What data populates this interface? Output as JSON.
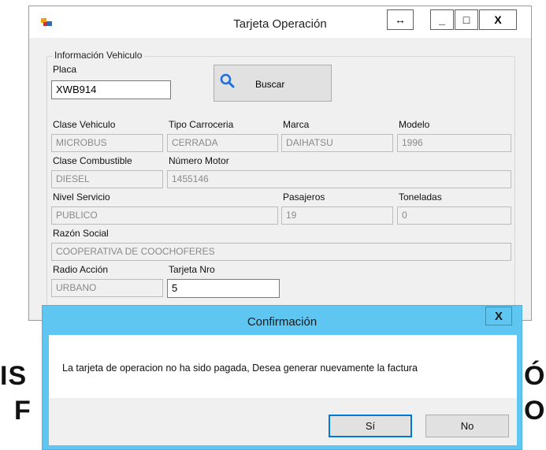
{
  "background": {
    "left_glyphs": "IS",
    "left_glyph_2": "F",
    "right_glyph_1": "Ó",
    "right_glyph_2": "O"
  },
  "window": {
    "title": "Tarjeta Operación",
    "buttons": {
      "resize": "↔",
      "minimize": "_",
      "maximize": "□",
      "close": "X"
    }
  },
  "form": {
    "group_title": "Información Vehiculo",
    "placa_label": "Placa",
    "placa_value": "XWB914",
    "search_label": "Buscar",
    "clase_vehiculo_label": "Clase Vehiculo",
    "clase_vehiculo_value": "MICROBUS",
    "tipo_carroceria_label": "Tipo Carroceria",
    "tipo_carroceria_value": "CERRADA",
    "marca_label": "Marca",
    "marca_value": "DAIHATSU",
    "modelo_label": "Modelo",
    "modelo_value": "1996",
    "clase_combustible_label": "Clase Combustible",
    "clase_combustible_value": "DIESEL",
    "numero_motor_label": "Número Motor",
    "numero_motor_value": "1455146",
    "nivel_servicio_label": "Nivel Servicio",
    "nivel_servicio_value": "PUBLICO",
    "pasajeros_label": "Pasajeros",
    "pasajeros_value": "19",
    "toneladas_label": "Toneladas",
    "toneladas_value": "0",
    "razon_social_label": "Razón Social",
    "razon_social_value": "COOPERATIVA DE COOCHOFERES",
    "radio_accion_label": "Radio Acción",
    "radio_accion_value": "URBANO",
    "tarjeta_nro_label": "Tarjeta Nro",
    "tarjeta_nro_value": "5"
  },
  "dialog": {
    "title": "Confirmación",
    "close": "X",
    "message": "La tarjeta de operacion no ha sido pagada, Desea generar nuevamente la factura",
    "yes_label": "Sí",
    "no_label": "No"
  },
  "colors": {
    "dialog_accent": "#5ec6f0",
    "window_bg": "#f0f0f0",
    "search_icon": "#1e6fd9"
  },
  "icons": [
    "app-icon",
    "search-icon",
    "close-icon"
  ]
}
